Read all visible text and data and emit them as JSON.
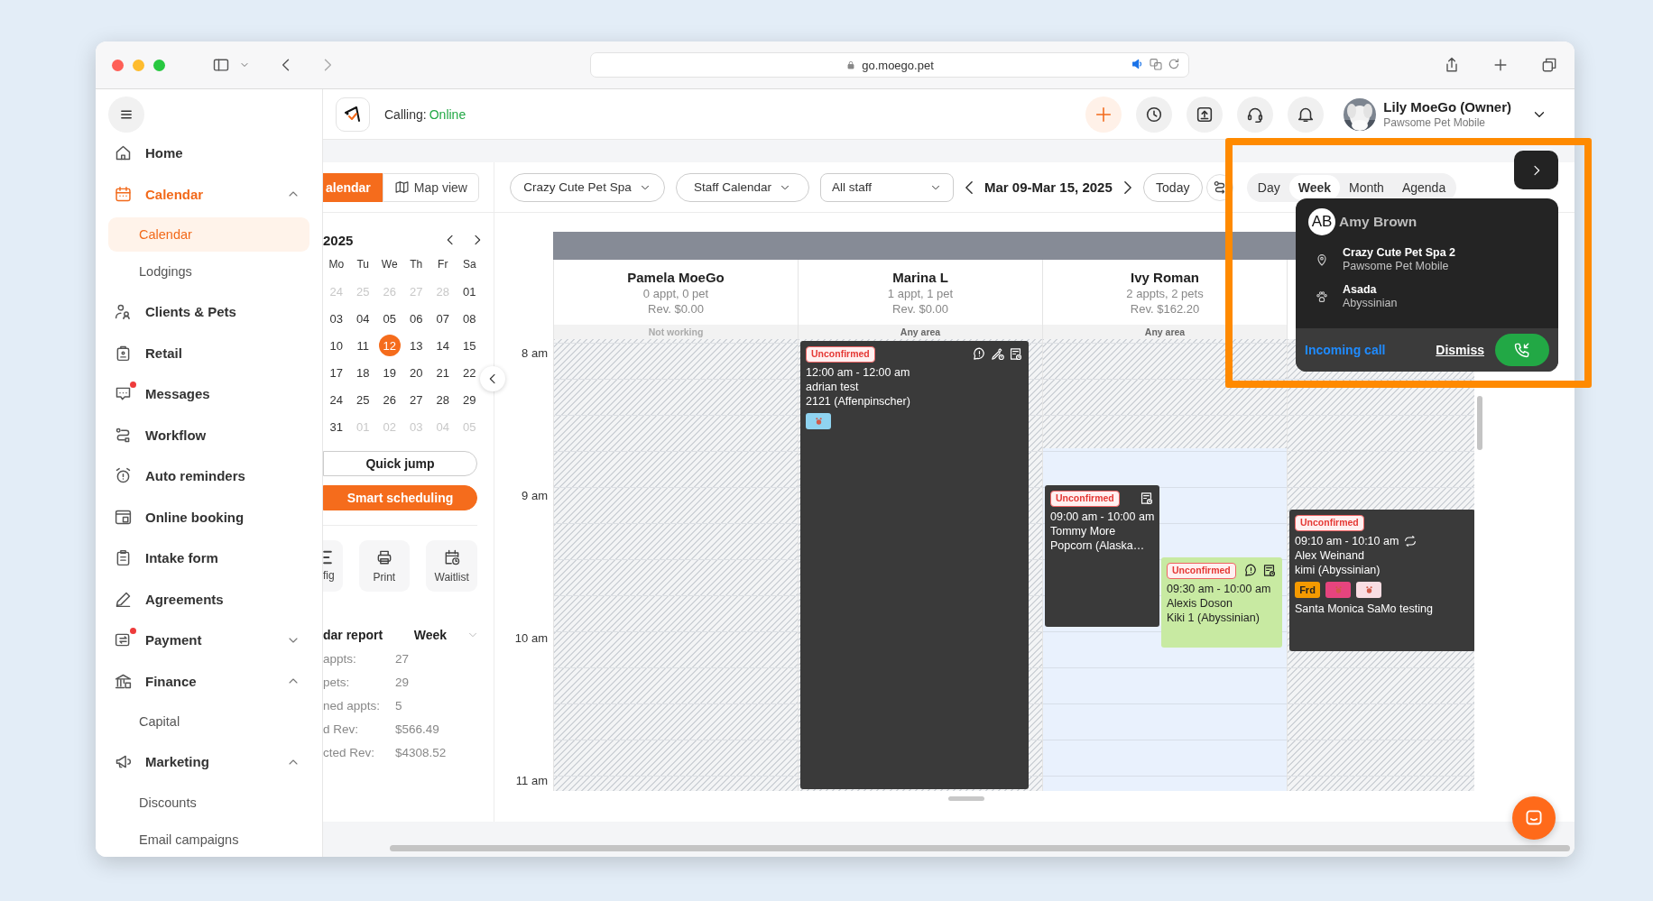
{
  "browser": {
    "url": "go.moego.pet"
  },
  "sidebar": {
    "items": [
      {
        "kind": "link",
        "label": "Home",
        "selected": false,
        "notification": false
      },
      {
        "kind": "group",
        "label": "Calendar",
        "selected": true,
        "notification": false,
        "expanded": true,
        "children": [
          {
            "label": "Calendar",
            "selected": true
          },
          {
            "label": "Lodgings",
            "selected": false
          }
        ]
      },
      {
        "kind": "link",
        "label": "Clients & Pets",
        "selected": false,
        "notification": false
      },
      {
        "kind": "link",
        "label": "Retail",
        "selected": false,
        "notification": false
      },
      {
        "kind": "link",
        "label": "Messages",
        "selected": false,
        "notification": true
      },
      {
        "kind": "link",
        "label": "Workflow",
        "selected": false,
        "notification": false
      },
      {
        "kind": "link",
        "label": "Auto reminders",
        "selected": false,
        "notification": false
      },
      {
        "kind": "link",
        "label": "Online booking",
        "selected": false,
        "notification": false
      },
      {
        "kind": "link",
        "label": "Intake form",
        "selected": false,
        "notification": false
      },
      {
        "kind": "link",
        "label": "Agreements",
        "selected": false,
        "notification": false
      },
      {
        "kind": "group",
        "label": "Payment",
        "selected": false,
        "notification": true,
        "expanded": false
      },
      {
        "kind": "group",
        "label": "Finance",
        "selected": false,
        "notification": false,
        "expanded": true,
        "children": [
          {
            "label": "Capital",
            "selected": false
          }
        ]
      },
      {
        "kind": "group",
        "label": "Marketing",
        "selected": false,
        "notification": false,
        "expanded": true,
        "children": [
          {
            "label": "Discounts",
            "selected": false
          },
          {
            "label": "Email campaigns",
            "selected": false
          }
        ]
      }
    ]
  },
  "header": {
    "status_label": "Calling:",
    "status_value": "Online",
    "user_name": "Lily MoeGo (Owner)",
    "user_business": "Pawsome Pet Mobile"
  },
  "view_toggle": [
    {
      "label": "alendar",
      "selected": true
    },
    {
      "label": "Map view",
      "selected": false
    }
  ],
  "mini_calendar": {
    "title": "2025",
    "weekdays": [
      "Mo",
      "Tu",
      "We",
      "Th",
      "Fr",
      "Sa"
    ],
    "weeks": [
      [
        {
          "day": "24",
          "muted": true,
          "selected": false
        },
        {
          "day": "25",
          "muted": true,
          "selected": false
        },
        {
          "day": "26",
          "muted": true,
          "selected": false
        },
        {
          "day": "27",
          "muted": true,
          "selected": false
        },
        {
          "day": "28",
          "muted": true,
          "selected": false
        },
        {
          "day": "01",
          "muted": false,
          "selected": false
        }
      ],
      [
        {
          "day": "03",
          "muted": false,
          "selected": false
        },
        {
          "day": "04",
          "muted": false,
          "selected": false
        },
        {
          "day": "05",
          "muted": false,
          "selected": false
        },
        {
          "day": "06",
          "muted": false,
          "selected": false
        },
        {
          "day": "07",
          "muted": false,
          "selected": false
        },
        {
          "day": "08",
          "muted": false,
          "selected": false
        }
      ],
      [
        {
          "day": "10",
          "muted": false,
          "selected": false
        },
        {
          "day": "11",
          "muted": false,
          "selected": false
        },
        {
          "day": "12",
          "muted": false,
          "selected": true
        },
        {
          "day": "13",
          "muted": false,
          "selected": false
        },
        {
          "day": "14",
          "muted": false,
          "selected": false
        },
        {
          "day": "15",
          "muted": false,
          "selected": false
        }
      ],
      [
        {
          "day": "17",
          "muted": false,
          "selected": false
        },
        {
          "day": "18",
          "muted": false,
          "selected": false
        },
        {
          "day": "19",
          "muted": false,
          "selected": false
        },
        {
          "day": "20",
          "muted": false,
          "selected": false
        },
        {
          "day": "21",
          "muted": false,
          "selected": false
        },
        {
          "day": "22",
          "muted": false,
          "selected": false
        }
      ],
      [
        {
          "day": "24",
          "muted": false,
          "selected": false
        },
        {
          "day": "25",
          "muted": false,
          "selected": false
        },
        {
          "day": "26",
          "muted": false,
          "selected": false
        },
        {
          "day": "27",
          "muted": false,
          "selected": false
        },
        {
          "day": "28",
          "muted": false,
          "selected": false
        },
        {
          "day": "29",
          "muted": false,
          "selected": false
        }
      ],
      [
        {
          "day": "31",
          "muted": false,
          "selected": false
        },
        {
          "day": "01",
          "muted": true,
          "selected": false
        },
        {
          "day": "02",
          "muted": true,
          "selected": false
        },
        {
          "day": "03",
          "muted": true,
          "selected": false
        },
        {
          "day": "04",
          "muted": true,
          "selected": false
        },
        {
          "day": "05",
          "muted": true,
          "selected": false
        }
      ]
    ]
  },
  "quick_jump": "Quick jump",
  "smart_scheduling": "Smart scheduling",
  "tools": [
    "fig",
    "Print",
    "Waitlist"
  ],
  "report": {
    "title": "dar report",
    "period": "Week",
    "stats": [
      {
        "label": "appts:",
        "value": "27"
      },
      {
        "label": "pets:",
        "value": "29"
      },
      {
        "label": "ned appts:",
        "value": "5"
      },
      {
        "label": "d Rev:",
        "value": "$566.49"
      },
      {
        "label": "cted Rev:",
        "value": "$4308.52"
      }
    ]
  },
  "toolbar": {
    "filters": [
      "Crazy Cute Pet Spa",
      "Staff Calendar",
      "All staff"
    ],
    "date_range": "Mar 09-Mar 15, 2025",
    "today": "Today",
    "views": [
      {
        "label": "Day",
        "selected": false
      },
      {
        "label": "Week",
        "selected": true
      },
      {
        "label": "Month",
        "selected": false
      },
      {
        "label": "Agenda",
        "selected": false
      }
    ]
  },
  "calendar": {
    "hours": [
      "8 am",
      "9 am",
      "10 am",
      "11 am"
    ],
    "columns": [
      {
        "name": "Pamela MoeGo",
        "summary": "0 appt, 0 pet",
        "revenue": "Rev. $0.00",
        "area": "Not working",
        "kind": "off"
      },
      {
        "name": "Marina L",
        "summary": "1 appt, 1 pet",
        "revenue": "Rev. $0.00",
        "area": "Any area",
        "kind": "off",
        "events": [
          {
            "kind": "dark",
            "status": "Unconfirmed",
            "time": "12:00 am - 12:00 am",
            "client": "adrian test",
            "pet": "2121 (Affenpinscher)",
            "alert": true,
            "vaccine": true,
            "agreement": true,
            "recurring": false,
            "tags": [
              {
                "kind": "icon",
                "color": "#8fd3f0"
              }
            ]
          }
        ]
      },
      {
        "name": "Ivy Roman",
        "summary": "2 appts, 2 pets",
        "revenue": "Rev. $162.20",
        "area": "Any area",
        "kind": "partial",
        "events": [
          {
            "kind": "dark",
            "status": "Unconfirmed",
            "time": "09:00 am - 10:00 am",
            "client": "Tommy More",
            "pet": "Popcorn (Alaska…",
            "alert": false,
            "vaccine": false,
            "agreement": true,
            "recurring": false
          },
          {
            "kind": "green",
            "status": "Unconfirmed",
            "time": "09:30 am - 10:00 am",
            "client": "Alexis Doson",
            "pet": "Kiki 1 (Abyssinian)",
            "alert": true,
            "vaccine": false,
            "agreement": true,
            "recurring": false
          }
        ]
      },
      {
        "kind": "off",
        "events": [
          {
            "kind": "dark",
            "status": "Unconfirmed",
            "time": "09:10 am - 10:10 am",
            "client": "Alex Weinand",
            "pet": "kimi (Abyssinian)",
            "alert": false,
            "vaccine": false,
            "agreement": false,
            "recurring": true,
            "tags": [
              {
                "kind": "text",
                "label": "Frd",
                "color": "#f59a00"
              },
              {
                "kind": "icon",
                "color": "#e6447e"
              },
              {
                "kind": "icon",
                "color": "#f9dde3"
              }
            ],
            "note": "Santa Monica SaMo testing"
          }
        ]
      }
    ]
  },
  "call_popup": {
    "initials": "AB",
    "caller": "Amy Brown",
    "business": "Crazy Cute Pet Spa 2",
    "business_sub": "Pawsome Pet Mobile",
    "pet": "Asada",
    "pet_breed": "Abyssinian",
    "status": "Incoming call",
    "dismiss": "Dismiss"
  }
}
